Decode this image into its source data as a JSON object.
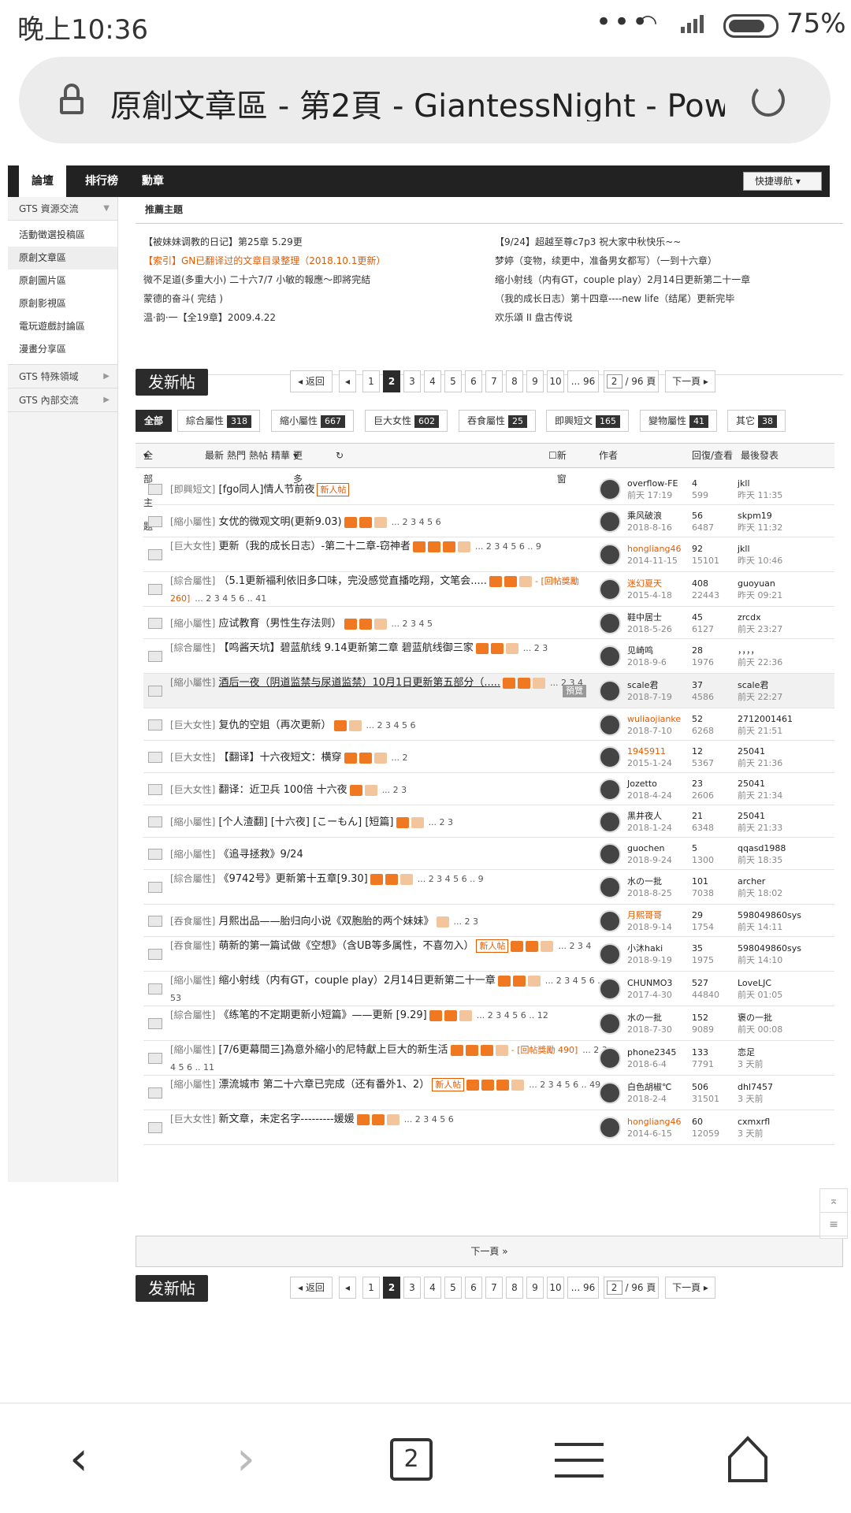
{
  "status": {
    "time": "晚上10:36",
    "battery": "75%"
  },
  "browser": {
    "title": "原創文章區 - 第2頁 - GiantessNight - Pow",
    "tab_count": "2"
  },
  "topnav": {
    "tabs": [
      "論壇",
      "排行榜",
      "勳章"
    ],
    "quick": "快捷導航"
  },
  "sidebar": {
    "group1": "GTS 資源交流",
    "items": [
      "活動徵選投稿區",
      "原創文章區",
      "原創圖片區",
      "原創影視區",
      "電玩遊戲討論區",
      "漫畫分享區"
    ],
    "group2": "GTS 特殊領域",
    "group3": "GTS 內部交流"
  },
  "recommend": {
    "heading": "推薦主題",
    "left": [
      "【被妹妹调教的日记】第25章 5.29更",
      "【索引】GN已翻译过的文章目录整理（2018.10.1更新）",
      "微不足道(多重大小) 二十六7/7 小敏的報應～即將完結",
      "蒙德的奋斗( 完结 )",
      "温·韵·一【全19章】2009.4.22"
    ],
    "right": [
      "【9/24】超越至尊c7p3 祝大家中秋快乐~~",
      "梦婷（变物，续更中，准备男女都写）（一到十六章）",
      "缩小射线（内有GT，couple play）2月14日更新第二十一章",
      "（我的成长日志）第十四章----new life（结尾）更新完毕",
      "欢乐頌 II 盘古传说"
    ]
  },
  "pager": {
    "new_post": "发新帖",
    "back": "返回",
    "pages": [
      "1",
      "2",
      "3",
      "4",
      "5",
      "6",
      "7",
      "8",
      "9",
      "10",
      "... 96"
    ],
    "current": "2",
    "input": "2",
    "total": "/ 96 頁",
    "next": "下一頁"
  },
  "filters": [
    {
      "label": "全部",
      "count": ""
    },
    {
      "label": "綜合屬性",
      "count": "318"
    },
    {
      "label": "縮小屬性",
      "count": "667"
    },
    {
      "label": "巨大女性",
      "count": "602"
    },
    {
      "label": "吞食屬性",
      "count": "25"
    },
    {
      "label": "即興短文",
      "count": "165"
    },
    {
      "label": "變物屬性",
      "count": "41"
    },
    {
      "label": "其它",
      "count": "38"
    }
  ],
  "table_head": {
    "all": "全部主題",
    "latest": "最新",
    "hot": "熱門",
    "hotpost": "熱帖",
    "digest": "精華",
    "more": "更多",
    "newwin": "新窗",
    "author": "作者",
    "replies": "回復/查看",
    "lastpost": "最後發表"
  },
  "threads": [
    {
      "cat": "[即興短文]",
      "title": "[fgo同人]情人节前夜",
      "badge": "新人帖",
      "icons": 0,
      "pages": "",
      "bounty": "",
      "author": "overflow-FE",
      "date": "前天 17:19",
      "author_orange": false,
      "replies": "4",
      "views": "599",
      "last_user": "jkll",
      "last_time": "昨天 11:35"
    },
    {
      "cat": "[縮小屬性]",
      "title": "女优的微观文明(更新9.03)",
      "badge": "",
      "icons": 3,
      "pages": "... 2 3 4 5 6",
      "bounty": "",
      "author": "乘风破浪",
      "date": "2018-8-16",
      "author_orange": false,
      "replies": "56",
      "views": "6487",
      "last_user": "skpm19",
      "last_time": "昨天 11:32"
    },
    {
      "cat": "[巨大女性]",
      "title": "更新（我的成长日志）-第二十二章-窃神者",
      "badge": "",
      "icons": 4,
      "pages": "... 2 3 4 5 6 .. 9",
      "bounty": "",
      "author": "hongliang46",
      "date": "2014-11-15",
      "author_orange": true,
      "replies": "92",
      "views": "15101",
      "last_user": "jkll",
      "last_time": "昨天 10:46"
    },
    {
      "cat": "[綜合屬性]",
      "title": "（5.1更新福利依旧多口味，完没感觉直播吃翔，文笔会.....",
      "badge": "",
      "icons": 3,
      "pages": "... 2 3 4 5 6 .. 41",
      "bounty": "回帖獎勵 260",
      "author": "迷幻夏天",
      "date": "2015-4-18",
      "author_orange": true,
      "replies": "408",
      "views": "22443",
      "last_user": "guoyuan",
      "last_time": "昨天 09:21"
    },
    {
      "cat": "[縮小屬性]",
      "title": "应试教育（男性生存法则）",
      "badge": "",
      "icons": 3,
      "pages": "... 2 3 4 5",
      "bounty": "",
      "author": "鞋中居士",
      "date": "2018-5-26",
      "author_orange": false,
      "replies": "45",
      "views": "6127",
      "last_user": "zrcdx",
      "last_time": "前天 23:27"
    },
    {
      "cat": "[綜合屬性]",
      "title": "【鸣酱天坑】碧蓝航线 9.14更新第二章 碧蓝航线御三家",
      "badge": "",
      "icons": 3,
      "pages": "... 2 3",
      "bounty": "",
      "author": "见崎鸣",
      "date": "2018-9-6",
      "author_orange": false,
      "replies": "28",
      "views": "1976",
      "last_user": "，，，，",
      "last_time": "前天 22:36"
    },
    {
      "cat": "[縮小屬性]",
      "title": "酒后一夜（阴道监禁与尿道监禁）10月1日更新第五部分（.....",
      "badge": "",
      "icons": 3,
      "pages": "... 2 3 4",
      "bounty": "",
      "author": "scale君",
      "date": "2018-7-19",
      "author_orange": false,
      "replies": "37",
      "views": "4586",
      "last_user": "scale君",
      "last_time": "前天 22:27",
      "preview": "預覽"
    },
    {
      "cat": "[巨大女性]",
      "title": "复仇的空姐（再次更新）",
      "badge": "",
      "icons": 2,
      "pages": "... 2 3 4 5 6",
      "bounty": "",
      "author": "wuliaojianke",
      "date": "2018-7-10",
      "author_orange": true,
      "replies": "52",
      "views": "6268",
      "last_user": "2712001461",
      "last_time": "前天 21:51"
    },
    {
      "cat": "[巨大女性]",
      "title": "【翻译】十六夜短文：横穿",
      "badge": "",
      "icons": 3,
      "pages": "... 2",
      "bounty": "",
      "author": "1945911",
      "date": "2015-1-24",
      "author_orange": true,
      "replies": "12",
      "views": "5367",
      "last_user": "25041",
      "last_time": "前天 21:36"
    },
    {
      "cat": "[巨大女性]",
      "title": "翻译：近卫兵 100倍 十六夜",
      "badge": "",
      "icons": 2,
      "pages": "... 2 3",
      "bounty": "",
      "author": "Jozetto",
      "date": "2018-4-24",
      "author_orange": false,
      "replies": "23",
      "views": "2606",
      "last_user": "25041",
      "last_time": "前天 21:34"
    },
    {
      "cat": "[縮小屬性]",
      "title": "[个人渣翻] [十六夜] [こーもん] [短篇]",
      "badge": "",
      "icons": 2,
      "pages": "... 2 3",
      "bounty": "",
      "author": "黑井夜人",
      "date": "2018-1-24",
      "author_orange": false,
      "replies": "21",
      "views": "6348",
      "last_user": "25041",
      "last_time": "前天 21:33"
    },
    {
      "cat": "[縮小屬性]",
      "title": "《追寻拯救》9/24",
      "badge": "",
      "icons": 0,
      "pages": "",
      "bounty": "",
      "author": "guochen",
      "date": "2018-9-24",
      "author_orange": false,
      "replies": "5",
      "views": "1300",
      "last_user": "qqasd1988",
      "last_time": "前天 18:35"
    },
    {
      "cat": "[綜合屬性]",
      "title": "《9742号》更新第十五章[9.30]",
      "badge": "",
      "icons": 3,
      "pages": "... 2 3 4 5 6 .. 9",
      "bounty": "",
      "author": "水の一批",
      "date": "2018-8-25",
      "author_orange": false,
      "replies": "101",
      "views": "7038",
      "last_user": "archer",
      "last_time": "前天 18:02"
    },
    {
      "cat": "[吞食屬性]",
      "title": "月熙出品——胎归向小说《双胞胎的两个妹妹》",
      "badge": "",
      "icons": 1,
      "pages": "... 2 3",
      "bounty": "",
      "author": "月熙哥哥",
      "date": "2018-9-14",
      "author_orange": true,
      "replies": "29",
      "views": "1754",
      "last_user": "598049860sys",
      "last_time": "前天 14:11"
    },
    {
      "cat": "[吞食屬性]",
      "title": "萌新的第一篇试做《空想》（含UB等多属性，不喜勿入）",
      "badge": "新人帖",
      "icons": 3,
      "pages": "... 2 3 4",
      "bounty": "",
      "author": "小沐haki",
      "date": "2018-9-19",
      "author_orange": false,
      "replies": "35",
      "views": "1975",
      "last_user": "598049860sys",
      "last_time": "前天 14:10"
    },
    {
      "cat": "[縮小屬性]",
      "title": "缩小射线（内有GT，couple play）2月14日更新第二十一章",
      "badge": "",
      "icons": 3,
      "pages": "... 2 3 4 5 6 .. 53",
      "bounty": "",
      "author": "CHUNMO3",
      "date": "2017-4-30",
      "author_orange": false,
      "replies": "527",
      "views": "44840",
      "last_user": "LoveLJC",
      "last_time": "前天 01:05"
    },
    {
      "cat": "[綜合屬性]",
      "title": "《练笔的不定期更新小短篇》——更新 [9.29]",
      "badge": "",
      "icons": 3,
      "pages": "... 2 3 4 5 6 .. 12",
      "bounty": "",
      "author": "水の一批",
      "date": "2018-7-30",
      "author_orange": false,
      "replies": "152",
      "views": "9089",
      "last_user": "褒の一批",
      "last_time": "前天 00:08"
    },
    {
      "cat": "[縮小屬性]",
      "title": "[7/6更幕間三]為意外縮小的尼特獻上巨大的新生活",
      "badge": "",
      "icons": 4,
      "pages": "... 2 3 4 5 6 .. 11",
      "bounty": "回帖獎勵 490",
      "author": "phone2345",
      "date": "2018-6-4",
      "author_orange": false,
      "replies": "133",
      "views": "7791",
      "last_user": "恋足",
      "last_time": "3 天前"
    },
    {
      "cat": "[縮小屬性]",
      "title": "漂流城市 第二十六章已完成（还有番外1、2）",
      "badge": "新人帖",
      "icons": 4,
      "pages": "... 2 3 4 5 6 .. 49",
      "bounty": "",
      "author": "白色胡椒℃",
      "date": "2018-2-4",
      "author_orange": false,
      "replies": "506",
      "views": "31501",
      "last_user": "dhl7457",
      "last_time": "3 天前"
    },
    {
      "cat": "[巨大女性]",
      "title": "新文章，未定名字---------媛媛",
      "badge": "",
      "icons": 3,
      "pages": "... 2 3 4 5 6",
      "bounty": "",
      "author": "hongliang46",
      "date": "2014-6-15",
      "author_orange": true,
      "replies": "60",
      "views": "12059",
      "last_user": "cxmxrfl",
      "last_time": "3 天前"
    }
  ],
  "next_page": "下一頁 »"
}
